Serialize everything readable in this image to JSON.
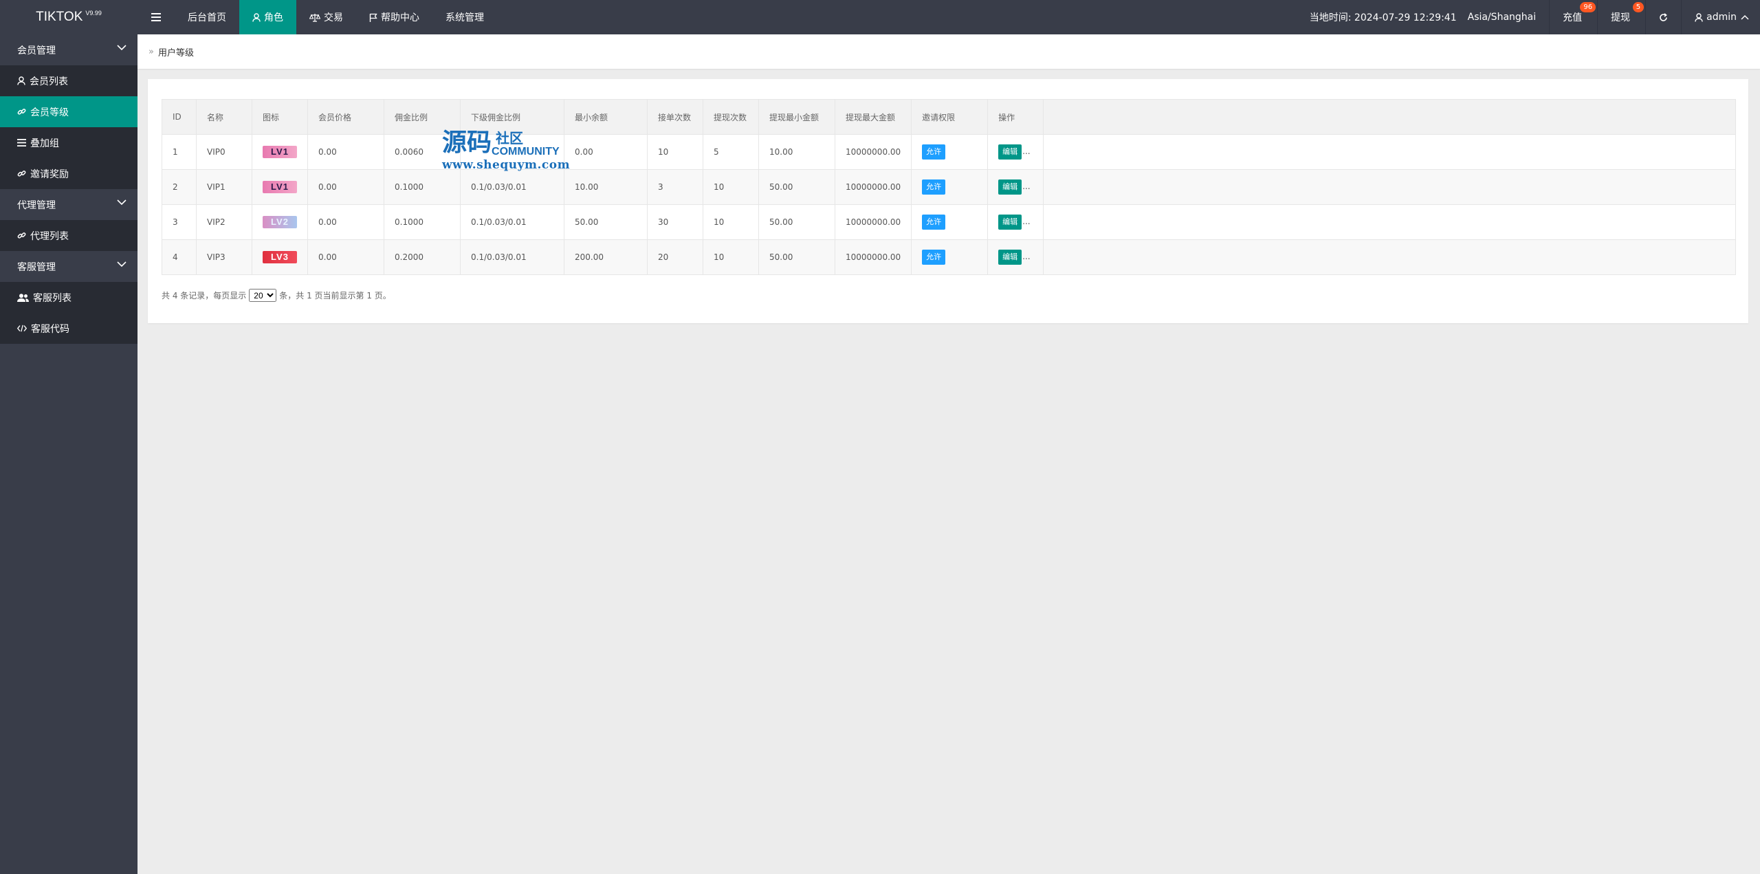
{
  "header": {
    "logo": "TIKTOK",
    "version": "V9.99",
    "nav": [
      {
        "label": "后台首页"
      },
      {
        "label": "角色"
      },
      {
        "label": "交易"
      },
      {
        "label": "帮助中心"
      },
      {
        "label": "系统管理"
      }
    ],
    "time": "当地时间: 2024-07-29 12:29:41",
    "timezone": "Asia/Shanghai",
    "recharge": "充值",
    "recharge_count": "96",
    "withdraw": "提现",
    "withdraw_count": "5",
    "user": "admin"
  },
  "sidebar": {
    "groups": [
      {
        "label": "会员管理",
        "items": [
          {
            "label": "会员列表",
            "icon": "user-icon"
          },
          {
            "label": "会员等级",
            "icon": "link-icon"
          },
          {
            "label": "叠加组",
            "icon": "list-icon"
          },
          {
            "label": "邀请奖励",
            "icon": "link-icon"
          }
        ]
      },
      {
        "label": "代理管理",
        "items": [
          {
            "label": "代理列表",
            "icon": "link-icon"
          }
        ]
      },
      {
        "label": "客服管理",
        "items": [
          {
            "label": "客服列表",
            "icon": "users-icon"
          },
          {
            "label": "客服代码",
            "icon": "code-icon"
          }
        ]
      }
    ]
  },
  "breadcrumb": "用户等级",
  "table": {
    "columns": [
      "ID",
      "名称",
      "图标",
      "会员价格",
      "佣金比例",
      "下级佣金比例",
      "最小余额",
      "接单次数",
      "提现次数",
      "提现最小金额",
      "提现最大金额",
      "邀请权限",
      "操作"
    ],
    "rows": [
      {
        "id": "1",
        "name": "VIP0",
        "icon": "LV1",
        "price": "0.00",
        "rate": "0.0060",
        "sub_rate": "",
        "min_balance": "0.00",
        "orders": "10",
        "withdraw_times": "5",
        "withdraw_min": "10.00",
        "withdraw_max": "10000000.00",
        "invite": "允许",
        "action": "编辑",
        "more": "..."
      },
      {
        "id": "2",
        "name": "VIP1",
        "icon": "LV1",
        "price": "0.00",
        "rate": "0.1000",
        "sub_rate": "0.1/0.03/0.01",
        "min_balance": "10.00",
        "orders": "3",
        "withdraw_times": "10",
        "withdraw_min": "50.00",
        "withdraw_max": "10000000.00",
        "invite": "允许",
        "action": "编辑",
        "more": "..."
      },
      {
        "id": "3",
        "name": "VIP2",
        "icon": "LV2",
        "price": "0.00",
        "rate": "0.1000",
        "sub_rate": "0.1/0.03/0.01",
        "min_balance": "50.00",
        "orders": "30",
        "withdraw_times": "10",
        "withdraw_min": "50.00",
        "withdraw_max": "10000000.00",
        "invite": "允许",
        "action": "编辑",
        "more": "..."
      },
      {
        "id": "4",
        "name": "VIP3",
        "icon": "LV3",
        "price": "0.00",
        "rate": "0.2000",
        "sub_rate": "0.1/0.03/0.01",
        "min_balance": "200.00",
        "orders": "20",
        "withdraw_times": "10",
        "withdraw_min": "50.00",
        "withdraw_max": "10000000.00",
        "invite": "允许",
        "action": "编辑",
        "more": "..."
      }
    ]
  },
  "pager": {
    "prefix": "共 4 条记录，每页显示",
    "page_size": "20",
    "suffix": "条，共 1 页当前显示第 1 页。"
  },
  "watermark": {
    "big": "源码",
    "small": "社区",
    "community": "COMMUNITY",
    "url": "www.shequym.com"
  },
  "colors": {
    "header_bg": "#393d49",
    "accent": "#009688",
    "allow_button": "#1e9fff",
    "badge": "#ff5722"
  }
}
